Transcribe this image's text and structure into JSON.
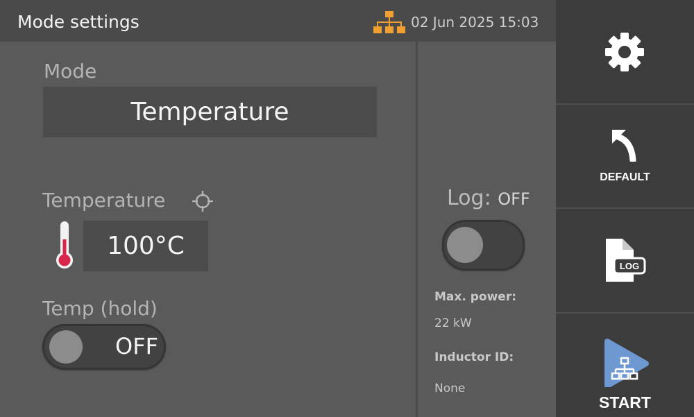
{
  "header": {
    "title": "Mode settings",
    "datetime": "02 Jun 2025 15:03",
    "network_icon": "network-tree-icon",
    "network_icon_color": "#f0a030"
  },
  "mode": {
    "label": "Mode",
    "value": "Temperature"
  },
  "temperature": {
    "label": "Temperature",
    "target_icon": "crosshair-icon",
    "thermometer_icon": "thermometer-icon",
    "thermometer_color": "#d8264a",
    "value": "100°C"
  },
  "temp_hold": {
    "label": "Temp (hold)",
    "state": "OFF"
  },
  "log": {
    "label": "Log:",
    "state": "OFF"
  },
  "info": {
    "max_power_label": "Max. power:",
    "max_power_value": "22 kW",
    "inductor_label": "Inductor ID:",
    "inductor_value": "None"
  },
  "sidebar": {
    "settings_icon": "gear-icon",
    "default_label": "DEFAULT",
    "default_icon": "back-arrow-icon",
    "log_icon": "log-file-icon",
    "log_icon_text": "LOG",
    "start_label": "START",
    "start_icon": "play-network-icon",
    "start_color": "#6e98d2"
  }
}
